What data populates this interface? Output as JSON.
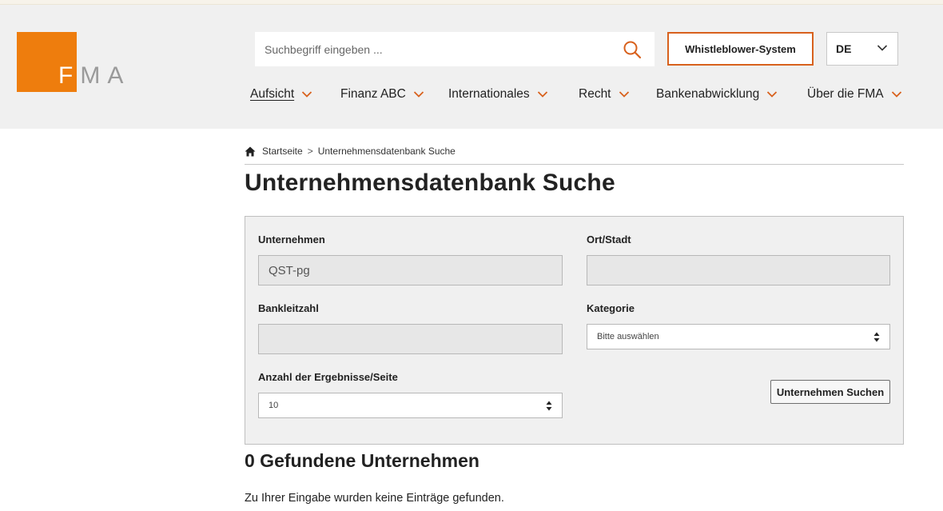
{
  "brand": {
    "logo_text_white": "F",
    "logo_text_grey": "MA",
    "color_orange": "#ee7d0d"
  },
  "header": {
    "search_placeholder": "Suchbegriff eingeben ...",
    "whistleblower_label": "Whistleblower-System",
    "language_selected": "DE",
    "nav": [
      {
        "label": "Aufsicht",
        "active": true
      },
      {
        "label": "Finanz ABC"
      },
      {
        "label": "Internationales"
      },
      {
        "label": "Recht"
      },
      {
        "label": "Bankenabwicklung"
      },
      {
        "label": "Über die FMA"
      }
    ]
  },
  "breadcrumb": {
    "home": "Startseite",
    "separator": ">",
    "current": "Unternehmensdatenbank Suche"
  },
  "page_title": "Unternehmensdatenbank Suche",
  "form": {
    "company_label": "Unternehmen",
    "company_value": "QST-pg",
    "city_label": "Ort/Stadt",
    "city_value": "",
    "bank_code_label": "Bankleitzahl",
    "bank_code_value": "",
    "category_label": "Kategorie",
    "category_selected": "Bitte auswählen",
    "results_per_page_label": "Anzahl der Ergebnisse/Seite",
    "results_per_page_selected": "10",
    "submit_label": "Unternehmen Suchen"
  },
  "results": {
    "heading": "0 Gefundene Unternehmen",
    "message": "Zu Ihrer Eingabe wurden keine Einträge gefunden."
  }
}
